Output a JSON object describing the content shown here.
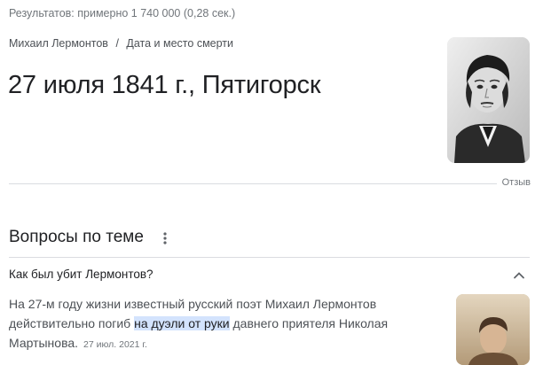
{
  "stats": "Результатов: примерно 1 740 000 (0,28 сек.)",
  "breadcrumb": {
    "entity": "Михаил Лермонтов",
    "separator": "/",
    "attribute": "Дата и место смерти"
  },
  "answer": "27 июля 1841 г., Пятигорск",
  "feedback": "Отзыв",
  "people_also_ask": {
    "title": "Вопросы по теме",
    "question": "Как был убит Лермонтов?",
    "answer_before": "На 27-м году жизни известный русский поэт Михаил Лермонтов действительно погиб ",
    "answer_highlight": "на дуэли от руки",
    "answer_after": " давнего приятеля Николая Мартынова.",
    "date": "27 июл. 2021 г."
  },
  "icons": {
    "more": "vertical-dots-icon",
    "collapse": "chevron-up-icon"
  },
  "colors": {
    "highlight": "#d3e3fd",
    "muted": "#70757a",
    "divider": "#dadce0"
  }
}
